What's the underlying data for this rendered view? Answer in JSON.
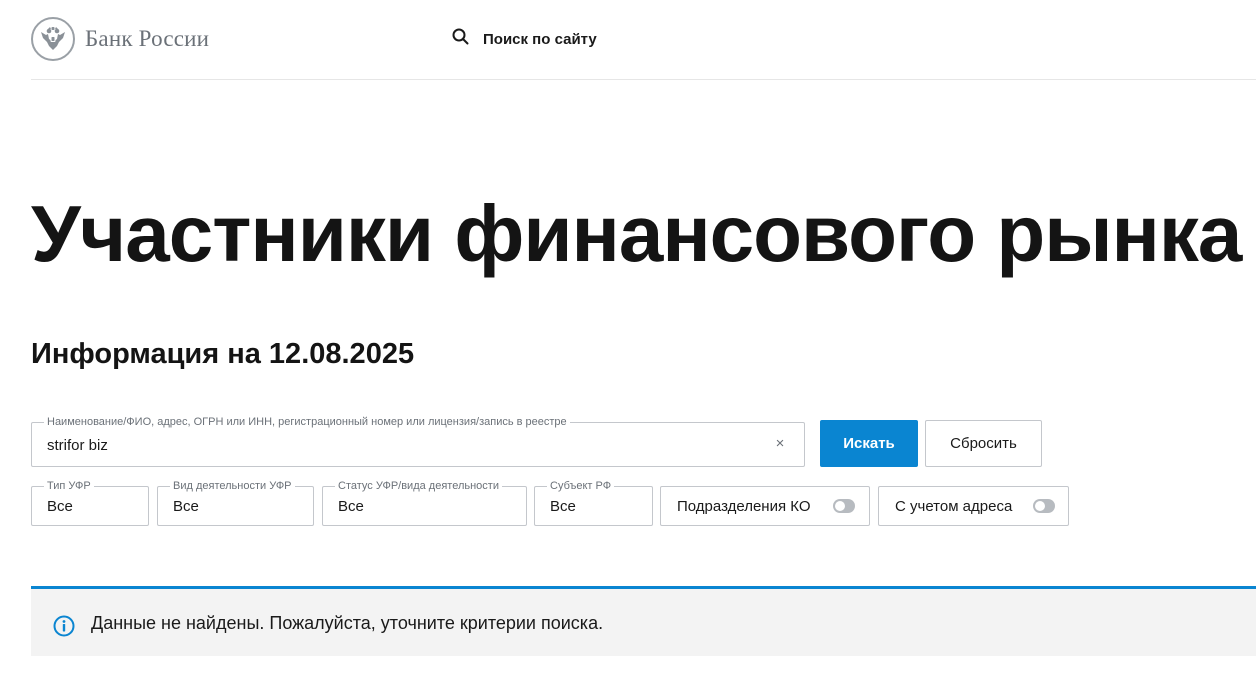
{
  "header": {
    "logo_text": "Банк России",
    "site_search_label": "Поиск по сайту",
    "icons": {
      "logo": "double-headed-eagle-emblem",
      "search": "search-icon"
    }
  },
  "page": {
    "title": "Участники финансового рынка",
    "subtitle": "Информация на 12.08.2025"
  },
  "search": {
    "legend": "Наименование/ФИО, адрес, ОГРН или ИНН, регистрационный номер или лицензия/запись в реестре",
    "value": "strifor biz",
    "clear_symbol": "×",
    "submit_label": "Искать",
    "reset_label": "Сбросить"
  },
  "filters": [
    {
      "legend": "Тип УФР",
      "value": "Все"
    },
    {
      "legend": "Вид деятельности УФР",
      "value": "Все"
    },
    {
      "legend": "Статус УФР/вида деятельности",
      "value": "Все"
    },
    {
      "legend": "Субъект РФ",
      "value": "Все"
    }
  ],
  "toggles": [
    {
      "label": "Подразделения КО",
      "on": false
    },
    {
      "label": "С учетом адреса",
      "on": false
    }
  ],
  "alert": {
    "text": "Данные не найдены. Пожалуйста, уточните критерии поиска.",
    "icon": "info-icon"
  },
  "colors": {
    "accent": "#0a85d1",
    "border": "#c4c7cc",
    "muted_text": "#6b7178",
    "alert_bg": "#f3f3f3",
    "toggle_off": "#b7bbc0"
  }
}
